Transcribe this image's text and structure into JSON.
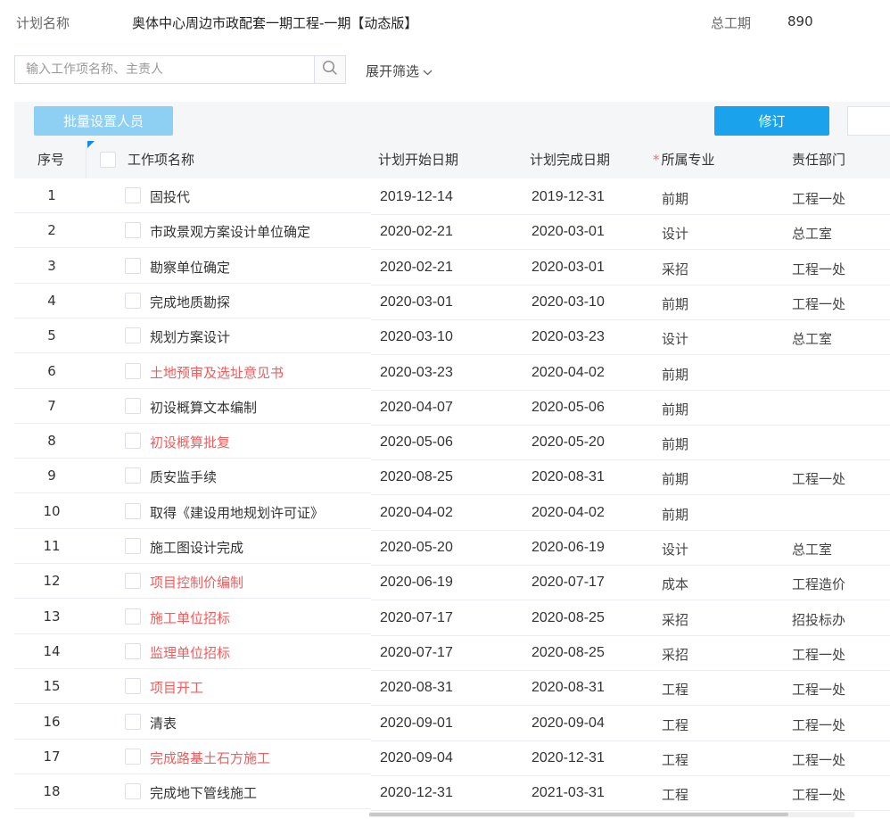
{
  "header": {
    "plan_label": "计划名称",
    "plan_name": "奥体中心周边市政配套一期工程-一期【动态版】",
    "duration_label": "总工期",
    "duration_value": "890"
  },
  "search": {
    "placeholder": "输入工作项名称、主责人",
    "value": "",
    "icon": "search-icon"
  },
  "filter": {
    "label": "展开筛选",
    "icon": "chevron-down-icon"
  },
  "toolbar": {
    "batch_label": "批量设置人员",
    "revise_label": "修订"
  },
  "colors": {
    "accent": "#1aa2ec",
    "accent_disabled": "#8ecff4",
    "highlight_text": "#f25c5c",
    "required_star": "#f56c6c"
  },
  "table": {
    "columns": {
      "index": "序号",
      "name": "工作项名称",
      "start": "计划开始日期",
      "end": "计划完成日期",
      "specialty": "所属专业",
      "specialty_required": "*",
      "dept": "责任部门"
    },
    "rows": [
      {
        "index": "1",
        "name": "固投代",
        "start": "2019-12-14",
        "end": "2019-12-31",
        "specialty": "前期",
        "dept": "工程一处",
        "highlight": false
      },
      {
        "index": "2",
        "name": "市政景观方案设计单位确定",
        "start": "2020-02-21",
        "end": "2020-03-01",
        "specialty": "设计",
        "dept": "总工室",
        "highlight": false
      },
      {
        "index": "3",
        "name": "勘察单位确定",
        "start": "2020-02-21",
        "end": "2020-03-01",
        "specialty": "采招",
        "dept": "工程一处",
        "highlight": false
      },
      {
        "index": "4",
        "name": "完成地质勘探",
        "start": "2020-03-01",
        "end": "2020-03-10",
        "specialty": "前期",
        "dept": "工程一处",
        "highlight": false
      },
      {
        "index": "5",
        "name": "规划方案设计",
        "start": "2020-03-10",
        "end": "2020-03-23",
        "specialty": "设计",
        "dept": "总工室",
        "highlight": false
      },
      {
        "index": "6",
        "name": "土地预审及选址意见书",
        "start": "2020-03-23",
        "end": "2020-04-02",
        "specialty": "前期",
        "dept": "",
        "highlight": true
      },
      {
        "index": "7",
        "name": "初设概算文本编制",
        "start": "2020-04-07",
        "end": "2020-05-06",
        "specialty": "前期",
        "dept": "",
        "highlight": false
      },
      {
        "index": "8",
        "name": "初设概算批复",
        "start": "2020-05-06",
        "end": "2020-05-20",
        "specialty": "前期",
        "dept": "",
        "highlight": true
      },
      {
        "index": "9",
        "name": "质安监手续",
        "start": "2020-08-25",
        "end": "2020-08-31",
        "specialty": "前期",
        "dept": "工程一处",
        "highlight": false
      },
      {
        "index": "10",
        "name": "取得《建设用地规划许可证》",
        "start": "2020-04-02",
        "end": "2020-04-02",
        "specialty": "前期",
        "dept": "",
        "highlight": false
      },
      {
        "index": "11",
        "name": "施工图设计完成",
        "start": "2020-05-20",
        "end": "2020-06-19",
        "specialty": "设计",
        "dept": "总工室",
        "highlight": false
      },
      {
        "index": "12",
        "name": "项目控制价编制",
        "start": "2020-06-19",
        "end": "2020-07-17",
        "specialty": "成本",
        "dept": "工程造价",
        "highlight": true
      },
      {
        "index": "13",
        "name": "施工单位招标",
        "start": "2020-07-17",
        "end": "2020-08-25",
        "specialty": "采招",
        "dept": "招投标办",
        "highlight": true
      },
      {
        "index": "14",
        "name": "监理单位招标",
        "start": "2020-07-17",
        "end": "2020-08-25",
        "specialty": "采招",
        "dept": "工程一处",
        "highlight": true
      },
      {
        "index": "15",
        "name": "项目开工",
        "start": "2020-08-31",
        "end": "2020-08-31",
        "specialty": "工程",
        "dept": "工程一处",
        "highlight": true
      },
      {
        "index": "16",
        "name": "清表",
        "start": "2020-09-01",
        "end": "2020-09-04",
        "specialty": "工程",
        "dept": "工程一处",
        "highlight": false
      },
      {
        "index": "17",
        "name": "完成路基土石方施工",
        "start": "2020-09-04",
        "end": "2020-12-31",
        "specialty": "工程",
        "dept": "工程一处",
        "highlight": true
      },
      {
        "index": "18",
        "name": "完成地下管线施工",
        "start": "2020-12-31",
        "end": "2021-03-31",
        "specialty": "工程",
        "dept": "工程一处",
        "highlight": false
      }
    ]
  }
}
